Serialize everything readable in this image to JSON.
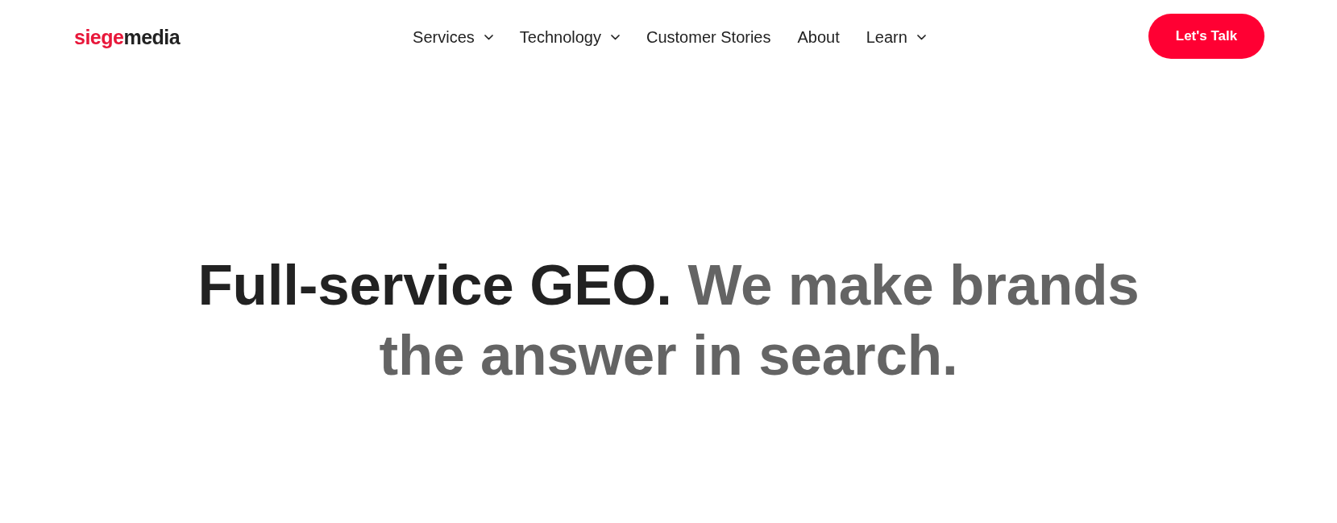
{
  "header": {
    "logo": {
      "accent": "siege",
      "rest": "media"
    },
    "nav": [
      {
        "label": "Services",
        "kind": "dropdown"
      },
      {
        "label": "Technology",
        "kind": "dropdown"
      },
      {
        "label": "Customer Stories",
        "kind": "link"
      },
      {
        "label": "About",
        "kind": "link"
      },
      {
        "label": "Learn",
        "kind": "dropdown"
      }
    ],
    "cta": {
      "label": "Let's Talk"
    }
  },
  "hero": {
    "headline": {
      "lead": "Full-service GEO.",
      "rest": "We make brands the answer in search."
    }
  }
}
